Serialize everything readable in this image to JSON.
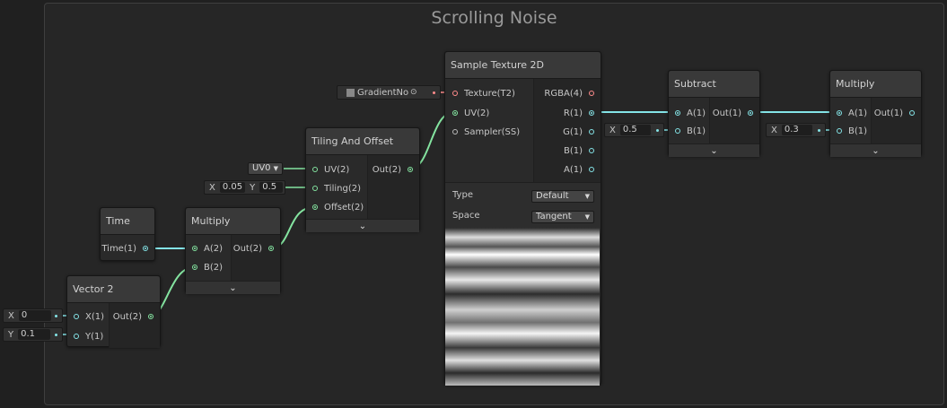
{
  "group": {
    "title": "Scrolling Noise"
  },
  "colors": {
    "wire_green": "#84e4a0",
    "wire_cyan": "#84e4e7",
    "wire_pink": "#ff8b8b",
    "background": "#202020"
  },
  "nodes": {
    "sample_texture": {
      "title": "Sample Texture 2D",
      "inputs": [
        "Texture(T2)",
        "UV(2)",
        "Sampler(SS)"
      ],
      "outputs": [
        "RGBA(4)",
        "R(1)",
        "G(1)",
        "B(1)",
        "A(1)"
      ],
      "type_label": "Type",
      "type_value": "Default",
      "space_label": "Space",
      "space_value": "Tangent"
    },
    "tiling_offset": {
      "title": "Tiling And Offset",
      "inputs": [
        "UV(2)",
        "Tiling(2)",
        "Offset(2)"
      ],
      "output": "Out(2)"
    },
    "time": {
      "title": "Time",
      "output": "Time(1)"
    },
    "multiply1": {
      "title": "Multiply",
      "inputs": [
        "A(2)",
        "B(2)"
      ],
      "output": "Out(2)"
    },
    "vector2": {
      "title": "Vector 2",
      "inputs": [
        "X(1)",
        "Y(1)"
      ],
      "output": "Out(2)"
    },
    "subtract": {
      "title": "Subtract",
      "inputs": [
        "A(1)",
        "B(1)"
      ],
      "output": "Out(1)"
    },
    "multiply2": {
      "title": "Multiply",
      "inputs": [
        "A(1)",
        "B(1)"
      ],
      "output": "Out(1)"
    }
  },
  "inline_inputs": {
    "texture": "GradientNois",
    "uv_channel": "UV0",
    "tiling_x_label": "X",
    "tiling_x": "0.05",
    "tiling_y_label": "Y",
    "tiling_y": "0.5",
    "vec_x_label": "X",
    "vec_x": "0",
    "vec_y_label": "Y",
    "vec_y": "0.1",
    "subtract_b_label": "X",
    "subtract_b": "0.5",
    "multiply_b_label": "X",
    "multiply_b": "0.3"
  },
  "icons": {
    "expand": "chevron-down-icon",
    "texture": "texture-icon",
    "target": "target-icon",
    "dropdown": "dropdown-arrow-icon"
  }
}
